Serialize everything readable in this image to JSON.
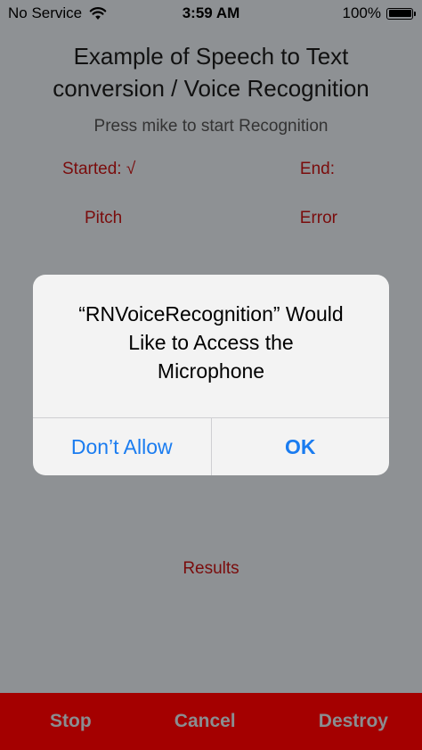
{
  "status_bar": {
    "carrier": "No Service",
    "time": "3:59 AM",
    "battery": "100%",
    "wifi_icon": "wifi-icon",
    "battery_icon": "battery-full-icon"
  },
  "main": {
    "title_line1": "Example of Speech to Text",
    "title_line2": "conversion / Voice Recognition",
    "subtitle": "Press mike to start Recognition",
    "started": "Started: √",
    "end": "End:",
    "pitch": "Pitch",
    "error": "Error",
    "results": "Results"
  },
  "bottom_bar": {
    "stop": "Stop",
    "cancel": "Cancel",
    "destroy": "Destroy"
  },
  "alert": {
    "title_line1": "“RNVoiceRecognition” Would",
    "title_line2": "Like to Access the",
    "title_line3": "Microphone",
    "dont_allow": "Don’t Allow",
    "ok": "OK"
  },
  "colors": {
    "accent_blue": "#1a7cf0",
    "bar_red": "#a40000",
    "label_red": "#7a0c0c",
    "dim_overlay": "#8e9194"
  }
}
